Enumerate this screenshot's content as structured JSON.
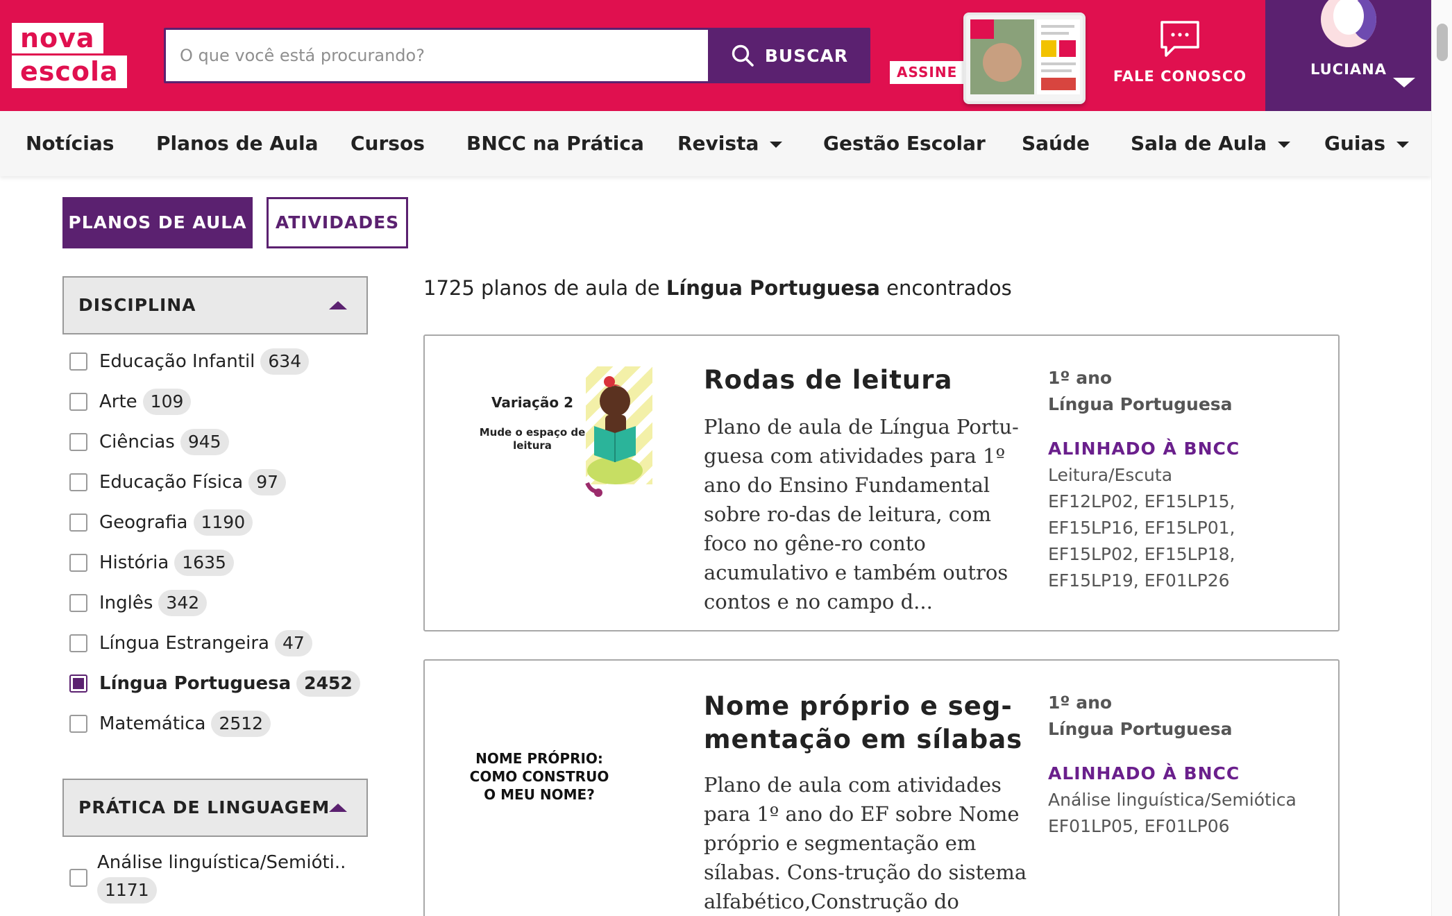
{
  "header": {
    "logo_line1": "nova",
    "logo_line2": "escola",
    "search_placeholder": "O que você está procurando?",
    "search_button": "BUSCAR",
    "subscribe_label": "ASSINE",
    "contact_label": "FALE CONOSCO",
    "user_name": "LUCIANA"
  },
  "nav": {
    "items": [
      {
        "label": "Notícias"
      },
      {
        "label": "Planos de Aula"
      },
      {
        "label": "Cursos"
      },
      {
        "label": "BNCC na Prática"
      },
      {
        "label": "Revista"
      },
      {
        "label": "Gestão Escolar"
      },
      {
        "label": "Saúde"
      },
      {
        "label": "Sala de Aula"
      },
      {
        "label": "Guias"
      }
    ]
  },
  "tabs": {
    "active": "PLANOS DE AULA",
    "inactive": "ATIVIDADES"
  },
  "filters": {
    "discipline_title": "DISCIPLINA",
    "options": [
      {
        "label": "Educação Infantil",
        "count": "634",
        "checked": false
      },
      {
        "label": "Arte",
        "count": "109",
        "checked": false
      },
      {
        "label": "Ciências",
        "count": "945",
        "checked": false
      },
      {
        "label": "Educação Física",
        "count": "97",
        "checked": false
      },
      {
        "label": "Geografia",
        "count": "1190",
        "checked": false
      },
      {
        "label": "História",
        "count": "1635",
        "checked": false
      },
      {
        "label": "Inglês",
        "count": "342",
        "checked": false
      },
      {
        "label": "Língua Estrangeira",
        "count": "47",
        "checked": false
      },
      {
        "label": "Língua Portuguesa",
        "count": "2452",
        "checked": true
      },
      {
        "label": "Matemática",
        "count": "2512",
        "checked": false
      }
    ],
    "language_title": "PRÁTICA DE LINGUAGEM",
    "language_options": [
      {
        "label": "Análise linguística/Semióti..",
        "count": "1171",
        "checked": false
      }
    ]
  },
  "results": {
    "count": "1725",
    "prefix": "planos de aula de",
    "subject": "Língua Portuguesa",
    "suffix": "encontrados"
  },
  "cards": [
    {
      "title": "Rodas de leitura",
      "description": "Plano de aula de Língua Portu-guesa com atividades para 1º ano do Ensino Fundamental sobre ro-das de leitura, com foco no gêne-ro conto acumulativo e também outros contos e no campo d...",
      "grade": "1º ano",
      "subject": "Língua Portuguesa",
      "bncc_label": "ALINHADO À BNCC",
      "bncc_field": "Leitura/Escuta",
      "bncc_codes": "EF12LP02, EF15LP15, EF15LP16, EF15LP01, EF15LP02, EF15LP18, EF15LP19, EF01LP26",
      "thumb_title": "Variação 2",
      "thumb_subtitle": "Mude o espaço de leitura"
    },
    {
      "title": "Nome próprio e seg-mentação em sílabas",
      "description": "Plano de aula com atividades para 1º ano do EF sobre Nome próprio e segmentação em sílabas. Cons-trução do sistema alfabético,Construção do sistema",
      "grade": "1º ano",
      "subject": "Língua Portuguesa",
      "bncc_label": "ALINHADO À BNCC",
      "bncc_field": "Análise linguística/Semiótica",
      "bncc_codes": "EF01LP05, EF01LP06",
      "thumb_title": "NOME PRÓPRIO: COMO CONSTRUO O MEU NOME?"
    }
  ],
  "colors": {
    "brand_pink": "#e0104f",
    "brand_purple": "#5b2170",
    "bncc_purple": "#6a1f8c"
  }
}
